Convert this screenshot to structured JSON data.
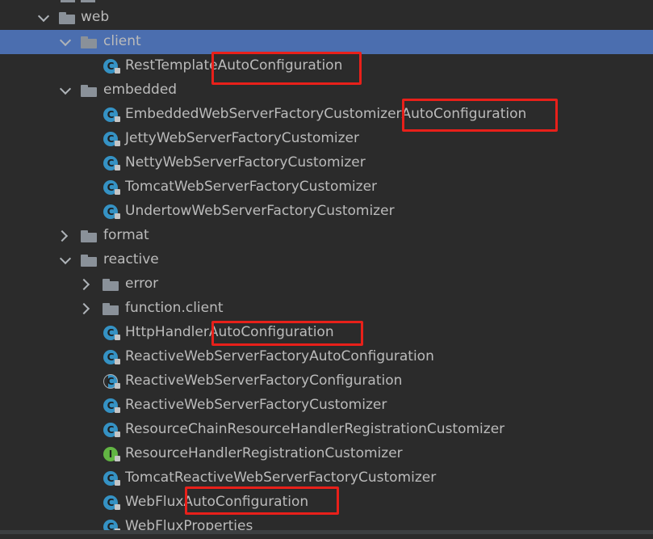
{
  "tree": {
    "items": [
      {
        "label": "web",
        "kind": "folder",
        "expanded": true
      },
      {
        "label": "client",
        "kind": "folder",
        "expanded": true,
        "selected": true
      },
      {
        "label": "RestTemplateAutoConfiguration",
        "kind": "class"
      },
      {
        "label": "embedded",
        "kind": "folder",
        "expanded": true
      },
      {
        "label": "EmbeddedWebServerFactoryCustomizerAutoConfiguration",
        "kind": "class"
      },
      {
        "label": "JettyWebServerFactoryCustomizer",
        "kind": "class"
      },
      {
        "label": "NettyWebServerFactoryCustomizer",
        "kind": "class"
      },
      {
        "label": "TomcatWebServerFactoryCustomizer",
        "kind": "class"
      },
      {
        "label": "UndertowWebServerFactoryCustomizer",
        "kind": "class"
      },
      {
        "label": "format",
        "kind": "folder",
        "expanded": false
      },
      {
        "label": "reactive",
        "kind": "folder",
        "expanded": true
      },
      {
        "label": "error",
        "kind": "folder",
        "expanded": false
      },
      {
        "label": "function.client",
        "kind": "folder",
        "expanded": false
      },
      {
        "label": "HttpHandlerAutoConfiguration",
        "kind": "class"
      },
      {
        "label": "ReactiveWebServerFactoryAutoConfiguration",
        "kind": "class"
      },
      {
        "label": "ReactiveWebServerFactoryConfiguration",
        "kind": "class-partial"
      },
      {
        "label": "ReactiveWebServerFactoryCustomizer",
        "kind": "class"
      },
      {
        "label": "ResourceChainResourceHandlerRegistrationCustomizer",
        "kind": "class"
      },
      {
        "label": "ResourceHandlerRegistrationCustomizer",
        "kind": "interface"
      },
      {
        "label": "TomcatReactiveWebServerFactoryCustomizer",
        "kind": "class"
      },
      {
        "label": "WebFluxAutoConfiguration",
        "kind": "class"
      },
      {
        "label": "WebFluxProperties",
        "kind": "class"
      }
    ],
    "icon_letters": {
      "class": "C",
      "interface": "I"
    }
  },
  "colors": {
    "background": "#2b2b2b",
    "selection": "#4b6eaf",
    "highlight_box": "#e8201a",
    "class_icon": "#3592c4",
    "interface_icon": "#62b543"
  },
  "icons": {
    "expanded": "chevron-down-icon",
    "collapsed": "chevron-right-icon",
    "folder": "folder-icon",
    "class": "class-icon",
    "interface": "interface-icon",
    "lock": "lock-icon"
  }
}
